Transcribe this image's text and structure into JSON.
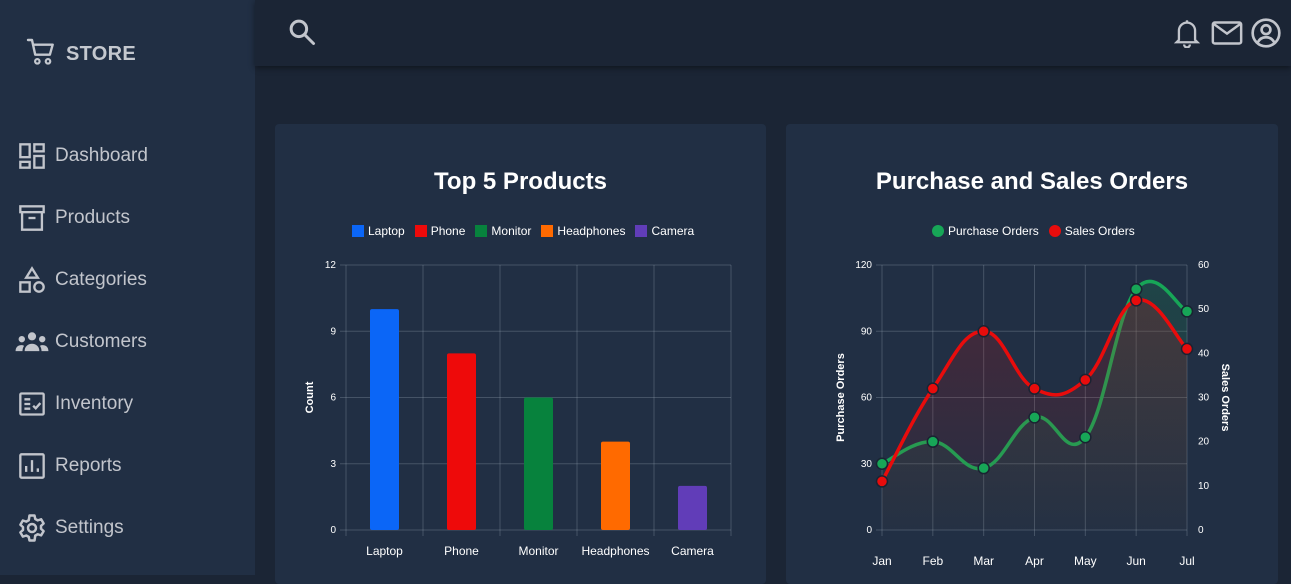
{
  "brand": {
    "label": "STORE",
    "icon": "cart-icon"
  },
  "sidebar": {
    "items": [
      {
        "label": "Dashboard",
        "icon": "dashboard-icon"
      },
      {
        "label": "Products",
        "icon": "archive-box-icon"
      },
      {
        "label": "Categories",
        "icon": "shapes-icon"
      },
      {
        "label": "Customers",
        "icon": "people-icon"
      },
      {
        "label": "Inventory",
        "icon": "checklist-icon"
      },
      {
        "label": "Reports",
        "icon": "bar-report-icon"
      },
      {
        "label": "Settings",
        "icon": "gear-icon"
      }
    ]
  },
  "topbar": {
    "search_icon": "search-icon",
    "bell_icon": "bell-icon",
    "mail_icon": "mail-icon",
    "account_icon": "account-circle-icon"
  },
  "colors": {
    "sidebar_bg": "#212f44",
    "page_bg": "#1b2535",
    "card_bg": "#212f44",
    "text_muted": "#c2c5cc"
  },
  "chart_data": [
    {
      "type": "bar",
      "title": "Top 5 Products",
      "categories": [
        "Laptop",
        "Phone",
        "Monitor",
        "Headphones",
        "Camera"
      ],
      "values": [
        10,
        8,
        6,
        4,
        2
      ],
      "colors": [
        "#0b66f7",
        "#ee0a0a",
        "#07823d",
        "#ff6a00",
        "#613db8"
      ],
      "legend": [
        "Laptop",
        "Phone",
        "Monitor",
        "Headphones",
        "Camera"
      ],
      "legend_position": "top",
      "xlabel": "",
      "ylabel": "Count",
      "ylim": [
        0,
        12
      ],
      "yticks": [
        0,
        3,
        6,
        9,
        12
      ],
      "grid": true
    },
    {
      "type": "line",
      "title": "Purchase and Sales Orders",
      "x": [
        "Jan",
        "Feb",
        "Mar",
        "Apr",
        "May",
        "Jun",
        "Jul"
      ],
      "series": [
        {
          "name": "Purchase Orders",
          "axis": "left",
          "color": "#17a657",
          "values": [
            30,
            40,
            28,
            51,
            42,
            109,
            99
          ]
        },
        {
          "name": "Sales Orders",
          "axis": "right",
          "color": "#e80c0c",
          "values": [
            11,
            32,
            45,
            32,
            34,
            52,
            41
          ]
        }
      ],
      "legend_position": "top",
      "ylabel_left": "Purchase Orders",
      "ylabel_right": "Sales Orders",
      "ylim_left": [
        0,
        120
      ],
      "yticks_left": [
        0,
        30,
        60,
        90,
        120
      ],
      "ylim_right": [
        0,
        60
      ],
      "yticks_right": [
        0,
        10,
        20,
        30,
        40,
        50,
        60
      ],
      "grid": true,
      "smooth": true,
      "fill": true
    }
  ]
}
